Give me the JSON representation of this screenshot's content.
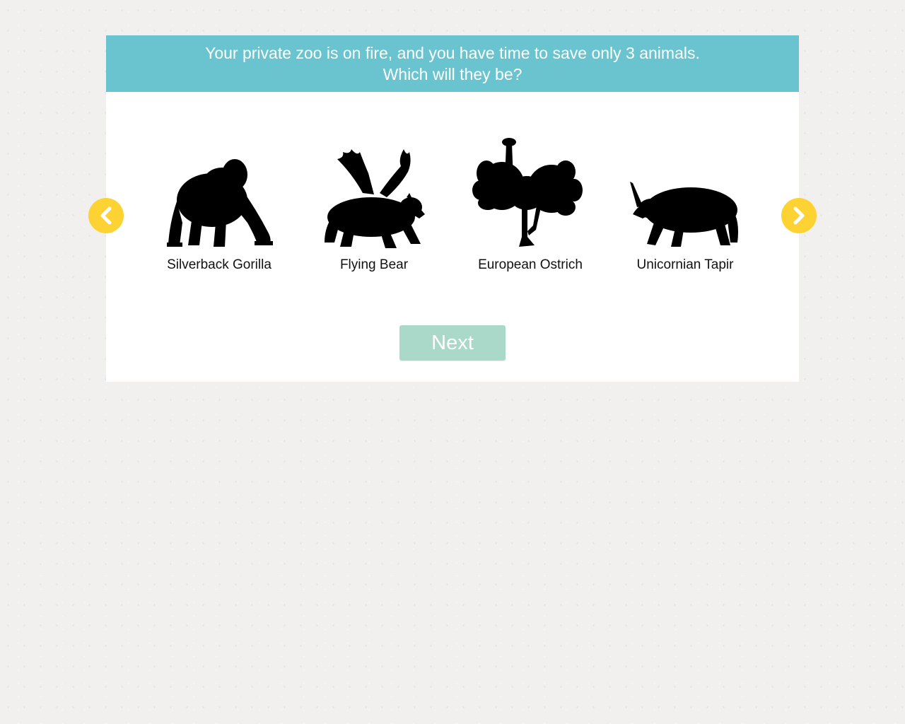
{
  "question": {
    "line1": "Your private zoo is on fire, and you have time to save only 3 animals.",
    "line2": "Which will they be?"
  },
  "carousel": {
    "prev_icon": "chevron-left-icon",
    "next_icon": "chevron-right-icon",
    "animals": [
      {
        "label": "Silverback Gorilla",
        "icon": "gorilla-silhouette-icon"
      },
      {
        "label": "Flying Bear",
        "icon": "winged-bear-silhouette-icon"
      },
      {
        "label": "European Ostrich",
        "icon": "ostrich-silhouette-icon"
      },
      {
        "label": "Unicornian Tapir",
        "icon": "horned-tapir-silhouette-icon"
      }
    ]
  },
  "actions": {
    "next_label": "Next"
  },
  "colors": {
    "header_bg": "#6ac4cf",
    "arrow_bg": "#fdd233",
    "next_bg": "#abd9c9",
    "page_bg": "#f1f0ee",
    "card_bg": "#ffffff"
  }
}
